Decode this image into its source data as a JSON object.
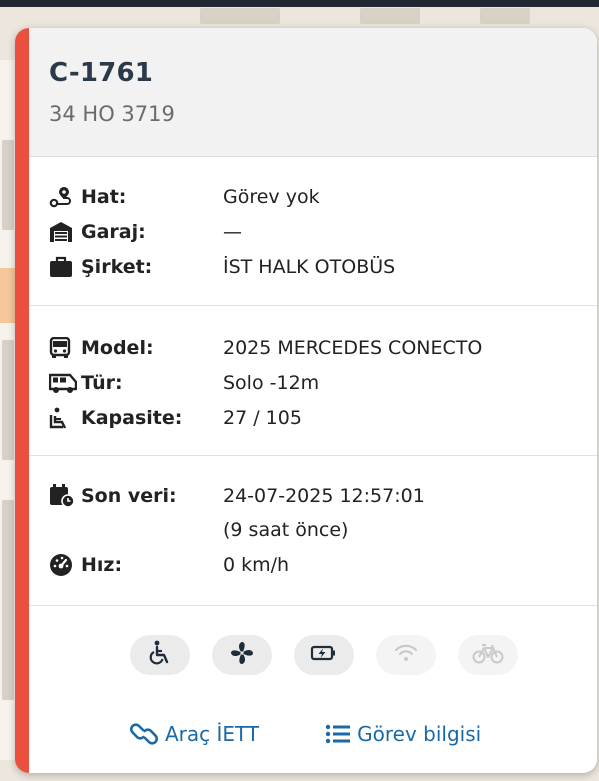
{
  "vehicle": {
    "code": "C-1761",
    "plate": "34 HO 3719"
  },
  "info_section_1": [
    {
      "icon": "route-icon",
      "label": "Hat:",
      "value": "Görev yok"
    },
    {
      "icon": "garage-icon",
      "label": "Garaj:",
      "value": "—"
    },
    {
      "icon": "briefcase-icon",
      "label": "Şirket:",
      "value": "İST HALK OTOBÜS"
    }
  ],
  "info_section_2": [
    {
      "icon": "bus-icon",
      "label": "Model:",
      "value": "2025 MERCEDES CONECTO"
    },
    {
      "icon": "van-icon",
      "label": "Tür:",
      "value": "Solo -12m"
    },
    {
      "icon": "seat-icon",
      "label": "Kapasite:",
      "value": "27 / 105"
    }
  ],
  "info_section_3": {
    "last_data_label": "Son veri:",
    "last_data_value": "24-07-2025 12:57:01",
    "last_data_relative": "(9 saat önce)",
    "speed_label": "Hız:",
    "speed_value": "0 km/h"
  },
  "features": [
    {
      "icon": "wheelchair-icon",
      "active": true
    },
    {
      "icon": "fan-icon",
      "active": true
    },
    {
      "icon": "usb-charging-icon",
      "active": true
    },
    {
      "icon": "wifi-icon",
      "active": false
    },
    {
      "icon": "bicycle-icon",
      "active": false
    }
  ],
  "links": {
    "vehicle_link": "Araç İETT",
    "task_link": "Görev bilgisi"
  },
  "colors": {
    "accent": "#e9503e",
    "link": "#1a6aa8",
    "title": "#2a3a4a"
  }
}
